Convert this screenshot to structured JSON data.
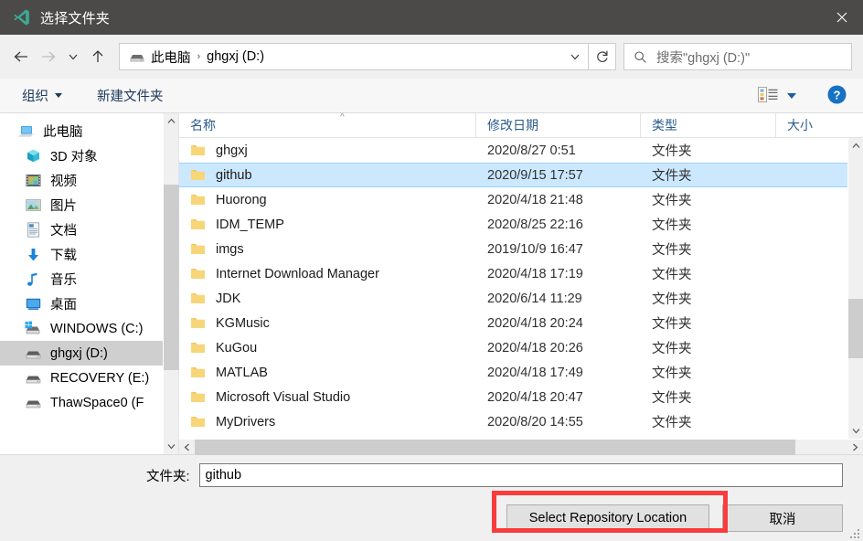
{
  "window": {
    "title": "选择文件夹",
    "app_icon": "vscode-icon",
    "close_label": "✕",
    "accent_blue": "#cce8ff",
    "title_bar_color": "#4c4a48",
    "annotation_color": "#fa3c3c"
  },
  "nav": {
    "back_icon": "back-arrow-icon",
    "forward_icon": "forward-arrow-icon",
    "recent_icon": "chevron-down-icon",
    "up_icon": "up-arrow-icon",
    "breadcrumb": {
      "drive_icon": "drive-icon",
      "parts": [
        "此电脑",
        "ghgxj (D:)"
      ],
      "separator": "›",
      "dropdown_icon": "chevron-down-icon"
    },
    "refresh_icon": "refresh-icon",
    "search": {
      "icon": "search-icon",
      "placeholder": "搜索\"ghgxj (D:)\"",
      "value": ""
    }
  },
  "toolbar": {
    "organize_label": "组织",
    "new_folder_label": "新建文件夹",
    "view_icon": "list-view-icon",
    "view_dropdown_icon": "chevron-down-icon",
    "help_icon": "help-icon",
    "help_label": "?"
  },
  "sidebar": {
    "items": [
      {
        "label": "此电脑",
        "icon": "computer-icon",
        "indent": 0,
        "selected": false
      },
      {
        "label": "3D 对象",
        "icon": "cube-icon",
        "indent": 1,
        "selected": false
      },
      {
        "label": "视频",
        "icon": "video-icon",
        "indent": 1,
        "selected": false
      },
      {
        "label": "图片",
        "icon": "pictures-icon",
        "indent": 1,
        "selected": false
      },
      {
        "label": "文档",
        "icon": "documents-icon",
        "indent": 1,
        "selected": false
      },
      {
        "label": "下载",
        "icon": "downloads-icon",
        "indent": 1,
        "selected": false
      },
      {
        "label": "音乐",
        "icon": "music-icon",
        "indent": 1,
        "selected": false
      },
      {
        "label": "桌面",
        "icon": "desktop-icon",
        "indent": 1,
        "selected": false
      },
      {
        "label": "WINDOWS (C:)",
        "icon": "windows-drive-icon",
        "indent": 1,
        "selected": false
      },
      {
        "label": "ghgxj (D:)",
        "icon": "drive-icon",
        "indent": 1,
        "selected": true
      },
      {
        "label": "RECOVERY (E:)",
        "icon": "drive-icon",
        "indent": 1,
        "selected": false
      },
      {
        "label": "ThawSpace0 (F",
        "icon": "drive-icon",
        "indent": 1,
        "selected": false
      }
    ],
    "scrollbar": {
      "up_icon": "chevron-up-icon",
      "down_icon": "chevron-down-icon"
    }
  },
  "filelist": {
    "columns": [
      "名称",
      "修改日期",
      "类型",
      "大小"
    ],
    "sort_indicator": "^",
    "rows": [
      {
        "name": "ghgxj",
        "date": "2020/8/27 0:51",
        "type": "文件夹",
        "size": "",
        "selected": false
      },
      {
        "name": "github",
        "date": "2020/9/15 17:57",
        "type": "文件夹",
        "size": "",
        "selected": true
      },
      {
        "name": "Huorong",
        "date": "2020/4/18 21:48",
        "type": "文件夹",
        "size": "",
        "selected": false
      },
      {
        "name": "IDM_TEMP",
        "date": "2020/8/25 22:16",
        "type": "文件夹",
        "size": "",
        "selected": false
      },
      {
        "name": "imgs",
        "date": "2019/10/9 16:47",
        "type": "文件夹",
        "size": "",
        "selected": false
      },
      {
        "name": "Internet Download Manager",
        "date": "2020/4/18 17:19",
        "type": "文件夹",
        "size": "",
        "selected": false
      },
      {
        "name": "JDK",
        "date": "2020/6/14 11:29",
        "type": "文件夹",
        "size": "",
        "selected": false
      },
      {
        "name": "KGMusic",
        "date": "2020/4/18 20:24",
        "type": "文件夹",
        "size": "",
        "selected": false
      },
      {
        "name": "KuGou",
        "date": "2020/4/18 20:26",
        "type": "文件夹",
        "size": "",
        "selected": false
      },
      {
        "name": "MATLAB",
        "date": "2020/4/18 17:49",
        "type": "文件夹",
        "size": "",
        "selected": false
      },
      {
        "name": "Microsoft Visual Studio",
        "date": "2020/4/18 20:47",
        "type": "文件夹",
        "size": "",
        "selected": false
      },
      {
        "name": "MyDrivers",
        "date": "2020/8/20 14:55",
        "type": "文件夹",
        "size": "",
        "selected": false
      }
    ],
    "vscroll": {
      "up_icon": "chevron-up-icon",
      "down_icon": "chevron-down-icon"
    },
    "hscroll": {
      "left_icon": "chevron-left-icon",
      "right_icon": "chevron-right-icon"
    }
  },
  "footer": {
    "folder_label": "文件夹:",
    "folder_value": "github",
    "select_button": "Select Repository Location",
    "cancel_button": "取消"
  }
}
